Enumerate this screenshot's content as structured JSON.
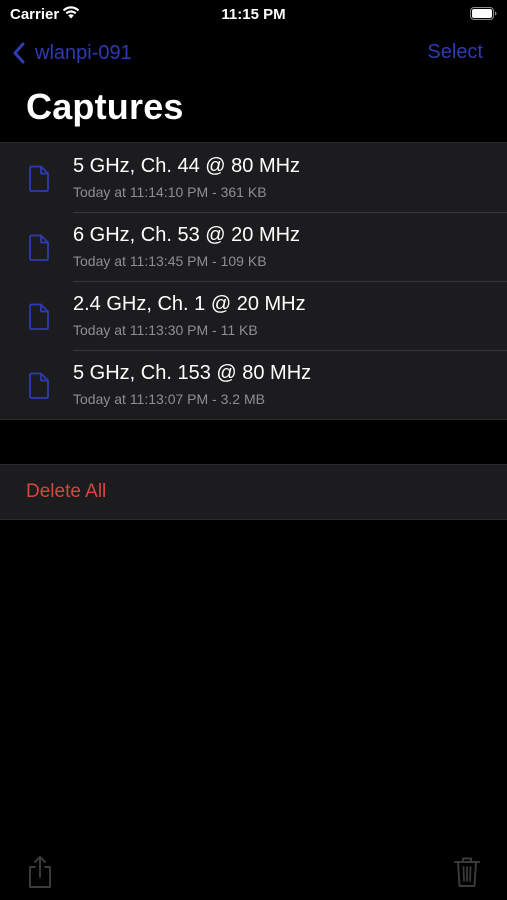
{
  "status_bar": {
    "carrier": "Carrier",
    "time": "11:15 PM",
    "icons": [
      "wifi-icon",
      "battery-icon"
    ]
  },
  "nav": {
    "back_label": "wlanpi-091",
    "select_label": "Select",
    "title": "Captures"
  },
  "captures": [
    {
      "title": "5 GHz, Ch. 44 @ 80 MHz",
      "subtitle": "Today at 11:14:10 PM - 361 KB"
    },
    {
      "title": "6 GHz, Ch. 53 @ 20 MHz",
      "subtitle": "Today at 11:13:45 PM - 109 KB"
    },
    {
      "title": "2.4 GHz, Ch. 1 @ 20 MHz",
      "subtitle": "Today at 11:13:30 PM - 11 KB"
    },
    {
      "title": "5 GHz, Ch. 153 @ 80 MHz",
      "subtitle": "Today at 11:13:07 PM - 3.2 MB"
    }
  ],
  "actions": {
    "delete_all_label": "Delete All"
  },
  "toolbar": {
    "icons": [
      "share-icon",
      "trash-icon"
    ]
  },
  "colors": {
    "background": "#000000",
    "row_background": "#1c1c1e",
    "tint": "#2f3bb0",
    "destructive": "#d5463f",
    "secondary_text": "#8e8e93",
    "disabled_icon": "#3a3a3c"
  }
}
